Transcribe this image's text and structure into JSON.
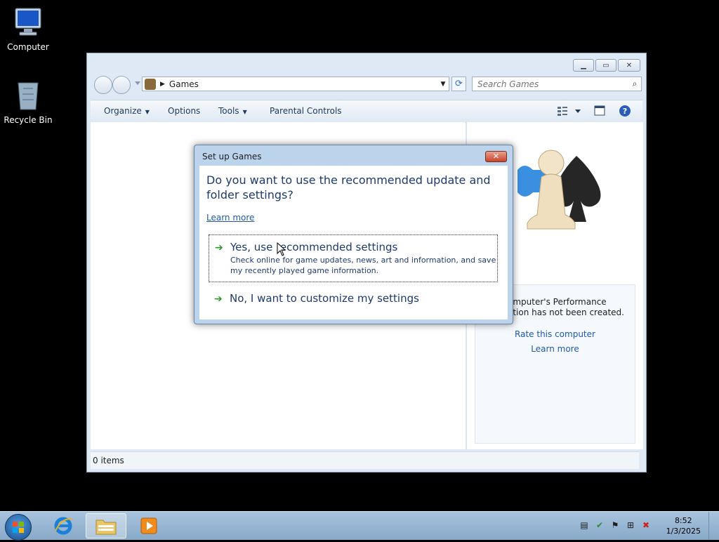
{
  "desktop": {
    "icons": [
      {
        "label": "Computer"
      },
      {
        "label": "Recycle Bin"
      }
    ]
  },
  "window": {
    "breadcrumb": [
      "Games"
    ],
    "search_placeholder": "Search Games",
    "toolbar": {
      "organize": "Organize",
      "options": "Options",
      "tools": "Tools",
      "parental_controls": "Parental Controls"
    },
    "details_pane": {
      "perf_text_line1": "omputer's Performance",
      "perf_text_line2": "ation has not been created.",
      "rate_link": "Rate this computer",
      "learn_link": "Learn more"
    },
    "status": "0 items"
  },
  "dialog": {
    "title": "Set up Games",
    "question": "Do you want to use the recommended update and folder settings?",
    "learn_more": "Learn more",
    "options": [
      {
        "title": "Yes, use recommended settings",
        "description": "Check online for game updates, news, art and information, and save my recently played game information.",
        "selected": true
      },
      {
        "title": "No, I want to customize my settings",
        "selected": false
      }
    ]
  },
  "taskbar": {
    "time": "8:52",
    "date": "1/3/2025"
  },
  "colors": {
    "accent": "#1e5aa8",
    "dialog_text": "#1e3a6e",
    "option_arrow": "#2b9a2b"
  }
}
